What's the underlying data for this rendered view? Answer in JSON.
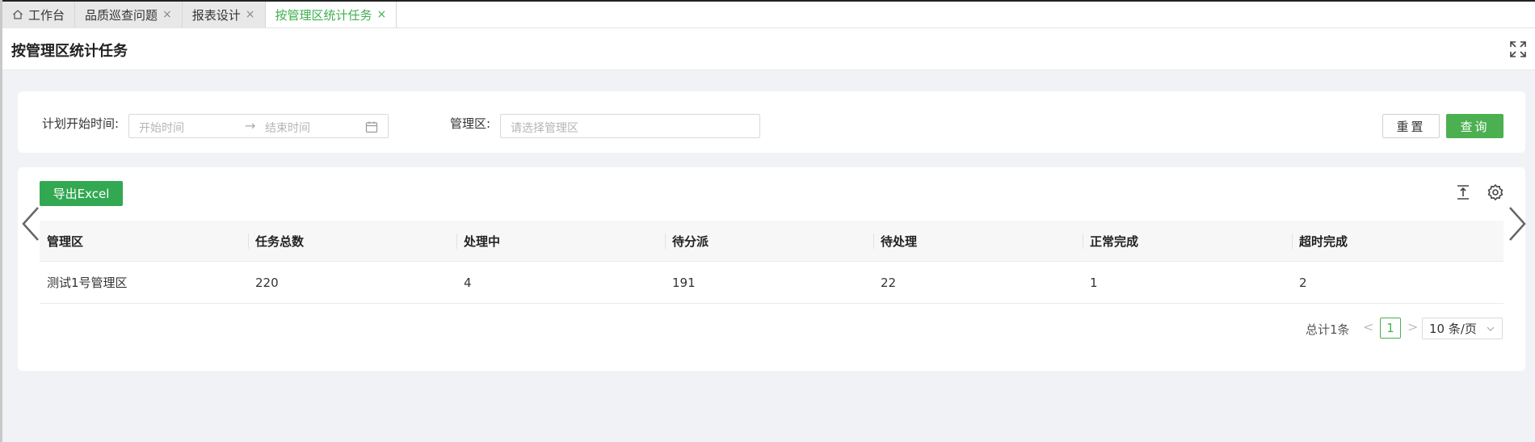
{
  "tabs": [
    {
      "label": "工作台",
      "icon": "home-icon",
      "closable": false,
      "active": false
    },
    {
      "label": "品质巡查问题",
      "closable": true,
      "active": false
    },
    {
      "label": "报表设计",
      "closable": true,
      "active": false
    },
    {
      "label": "按管理区统计任务",
      "closable": true,
      "active": true
    }
  ],
  "tab_close_glyph": "×",
  "header": {
    "title": "按管理区统计任务",
    "fullscreen_icon": "fullscreen-icon"
  },
  "filter": {
    "plan_start_label": "计划开始时间:",
    "start_placeholder": "开始时间",
    "end_placeholder": "结束时间",
    "range_arrow": "→",
    "mgmt_area_label": "管理区:",
    "mgmt_area_placeholder": "请选择管理区",
    "reset_label": "重置",
    "query_label": "查询"
  },
  "table": {
    "export_label": "导出Excel",
    "columns": [
      "管理区",
      "任务总数",
      "处理中",
      "待分派",
      "待处理",
      "正常完成",
      "超时完成"
    ],
    "rows": [
      [
        "测试1号管理区",
        "220",
        "4",
        "191",
        "22",
        "1",
        "2"
      ]
    ]
  },
  "pagination": {
    "total_label": "总计1条",
    "prev": "<",
    "current_page": "1",
    "next": ">",
    "page_size": "10 条/页"
  },
  "colors": {
    "accent": "#4caf50",
    "export_button": "#33a852",
    "active_tab": "#3eaf4e"
  }
}
